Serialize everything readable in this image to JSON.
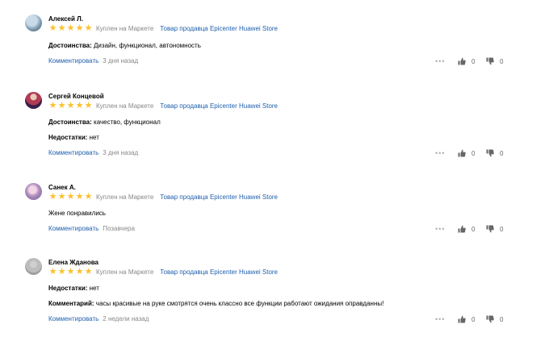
{
  "reviews": [
    {
      "author": "Алексей Л.",
      "stars": "★★★★★",
      "bought": "Куплен на Маркете",
      "seller": "Товар продавца Epicenter Huawei Store",
      "fields": [
        {
          "label": "Достоинства:",
          "value": "Дизайн, функционал, автономность"
        }
      ],
      "comment_label": "Комментировать",
      "date": "3 дня назад",
      "likes": "0",
      "dislikes": "0"
    },
    {
      "author": "Сергей Концевой",
      "stars": "★★★★★",
      "bought": "Куплен на Маркете",
      "seller": "Товар продавца Epicenter Huawei Store",
      "fields": [
        {
          "label": "Достоинства:",
          "value": "качество, функционал"
        },
        {
          "label": "Недостатки:",
          "value": "нет"
        }
      ],
      "comment_label": "Комментировать",
      "date": "3 дня назад",
      "likes": "0",
      "dislikes": "0"
    },
    {
      "author": "Санек А.",
      "stars": "★★★★★",
      "bought": "Куплен на Маркете",
      "seller": "Товар продавца Epicenter Huawei Store",
      "fields": [
        {
          "label": "",
          "value": "Жене понравились"
        }
      ],
      "comment_label": "Комментировать",
      "date": "Позавчера",
      "likes": "0",
      "dislikes": "0"
    },
    {
      "author": "Елена Жданова",
      "stars": "★★★★★",
      "bought": "Куплен на Маркете",
      "seller": "Товар продавца Epicenter Huawei Store",
      "fields": [
        {
          "label": "Недостатки:",
          "value": "нет"
        },
        {
          "label": "Комментарий:",
          "value": "часы красивые на руке смотрятся очень классно все функции работают ожидания оправданны!"
        }
      ],
      "comment_label": "Комментировать",
      "date": "2 недели назад",
      "likes": "0",
      "dislikes": "0"
    }
  ],
  "icons": {
    "more": "more-dots-icon",
    "like": "thumb-up-icon",
    "dislike": "thumb-down-icon"
  },
  "colors": {
    "star": "#fbc02d",
    "link": "#1f5fae",
    "muted": "#888888"
  }
}
